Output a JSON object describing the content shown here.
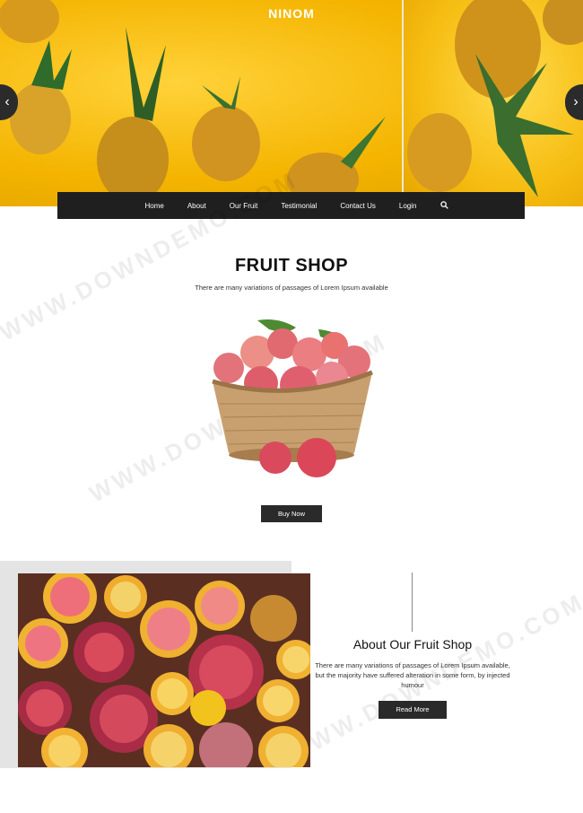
{
  "brand": "NINOM",
  "nav": {
    "items": [
      "Home",
      "About",
      "Our Fruit",
      "Testimonial",
      "Contact Us",
      "Login"
    ],
    "search_icon": "search-icon"
  },
  "slider": {
    "prev_icon": "chevron-left-icon",
    "next_icon": "chevron-right-icon",
    "prev_glyph": "‹",
    "next_glyph": "›"
  },
  "shop": {
    "title": "FRUIT SHOP",
    "subtitle": "There are many variations of passages of Lorem Ipsum available",
    "button": "Buy Now"
  },
  "about": {
    "title": "About Our Fruit Shop",
    "text": "There are many variations of passages of Lorem Ipsum available, but the majority have suffered alteration in some form, by injected humour",
    "button": "Read More"
  },
  "watermark": "WWW.DOWNDEMO.COM",
  "colors": {
    "accent_yellow": "#f4b400",
    "dark": "#1f1f1f"
  }
}
